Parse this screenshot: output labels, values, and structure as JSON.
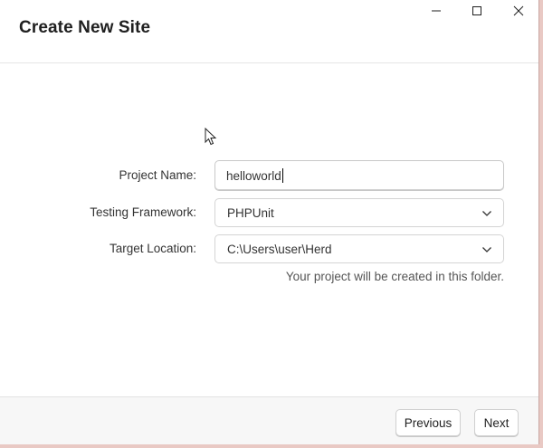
{
  "window": {
    "title": "Create New Site"
  },
  "form": {
    "project_name": {
      "label": "Project Name:",
      "value": "helloworld"
    },
    "testing_framework": {
      "label": "Testing Framework:",
      "value": "PHPUnit"
    },
    "target_location": {
      "label": "Target Location:",
      "value": "C:\\Users\\user\\Herd",
      "help": "Your project will be created in this folder."
    }
  },
  "footer": {
    "previous_label": "Previous",
    "next_label": "Next"
  },
  "icons": {
    "minimize": "minimize-icon",
    "maximize": "maximize-icon",
    "close": "close-icon",
    "dropdown": "chevron-down-icon",
    "pointer": "mouse-pointer-icon"
  },
  "colors": {
    "background": "#ffffff",
    "footer": "#f7f7f7",
    "desktop": "#e9c9c4",
    "text": "#333333"
  }
}
